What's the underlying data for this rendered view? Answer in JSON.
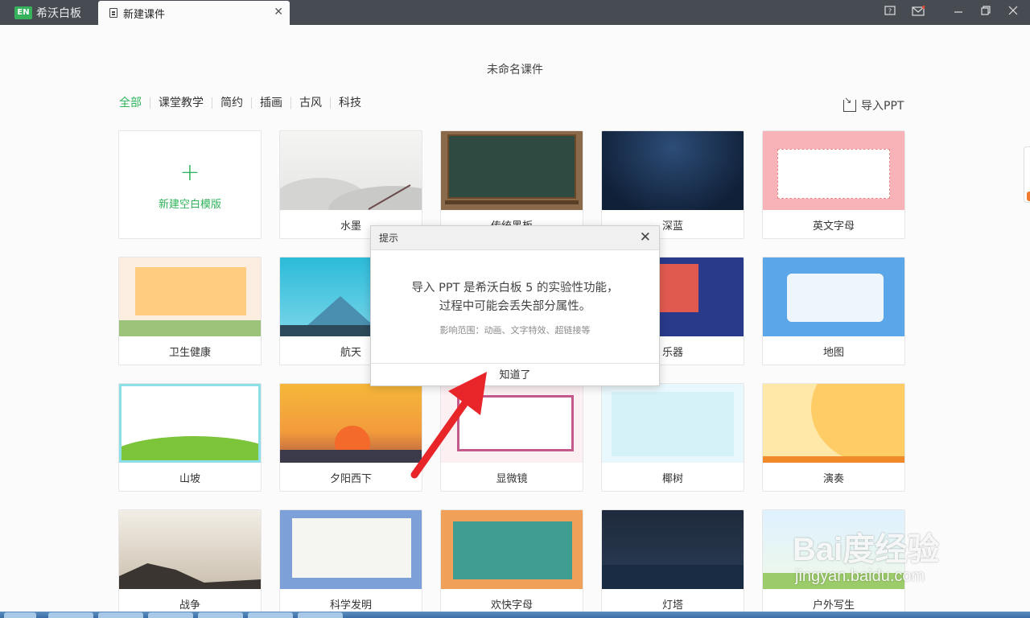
{
  "titlebar": {
    "app_logo": "EN",
    "app_name": "希沃白板",
    "doc_tab": "新建课件",
    "icons": [
      "help-icon",
      "mail-icon",
      "minimize-icon",
      "restore-icon",
      "close-icon"
    ]
  },
  "page_title": "未命名课件",
  "filters": [
    "全部",
    "课堂教学",
    "简约",
    "插画",
    "古风",
    "科技"
  ],
  "active_filter": "全部",
  "import_ppt": "导入PPT",
  "new_template": {
    "plus": "+",
    "label": "新建空白模版"
  },
  "templates": [
    {
      "label": "水墨"
    },
    {
      "label": "传统黑板"
    },
    {
      "label": "深蓝"
    },
    {
      "label": "英文字母"
    },
    {
      "label": "卫生健康"
    },
    {
      "label": "航天"
    },
    {
      "label": "乐器"
    },
    {
      "label": "地图"
    },
    {
      "label": "山坡"
    },
    {
      "label": "夕阳西下"
    },
    {
      "label": "显微镜"
    },
    {
      "label": "椰树"
    },
    {
      "label": "演奏"
    },
    {
      "label": "战争"
    },
    {
      "label": "科学发明"
    },
    {
      "label": "欢快字母"
    },
    {
      "label": "灯塔"
    },
    {
      "label": "户外写生"
    }
  ],
  "modal": {
    "title": "提示",
    "close": "✕",
    "message_line1": "导入 PPT 是希沃白板 5 的实验性功能，",
    "message_line2": "过程中可能会丢失部分属性。",
    "sub": "影响范围：动画、文字特效、超链接等",
    "button": "知道了"
  },
  "watermark": {
    "text": "Bai度经验",
    "url": "jingyan.baidu.com"
  },
  "colors": {
    "accent": "#2fb35a",
    "titlebar": "#474b52",
    "arrow": "#e8262a"
  }
}
